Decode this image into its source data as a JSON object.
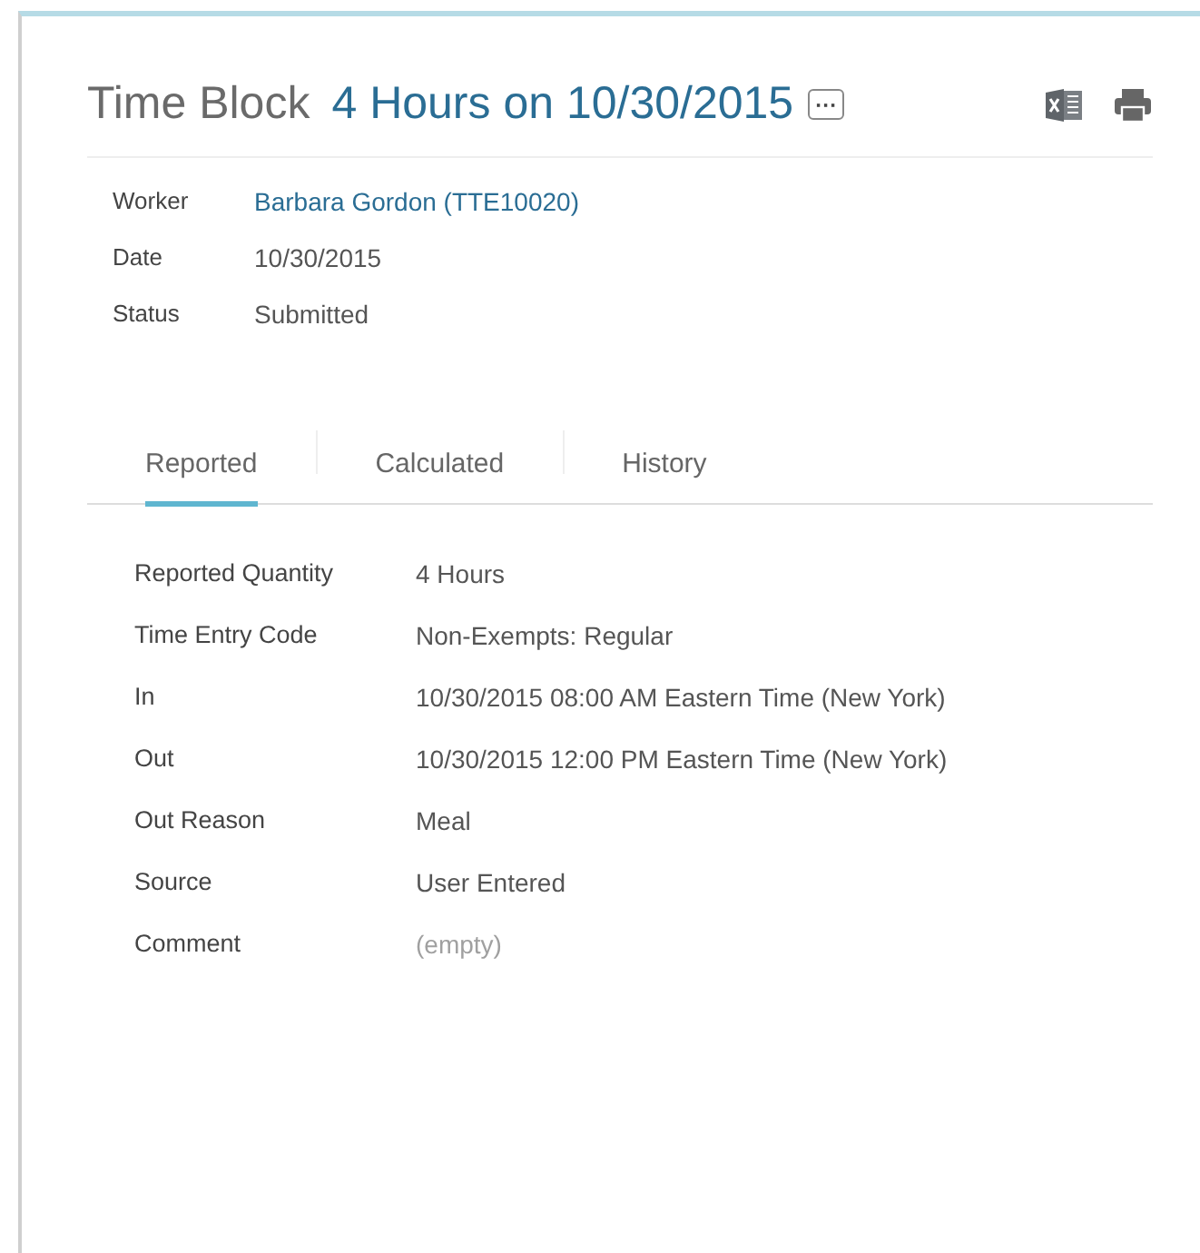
{
  "header": {
    "title": "Time Block",
    "subtitle": "4 Hours on 10/30/2015",
    "more_button": "···"
  },
  "summary": [
    {
      "label": "Worker",
      "value": "Barbara Gordon (TTE10020)",
      "kind": "link"
    },
    {
      "label": "Date",
      "value": "10/30/2015",
      "kind": "text"
    },
    {
      "label": "Status",
      "value": "Submitted",
      "kind": "text"
    }
  ],
  "tabs": [
    {
      "label": "Reported",
      "selected": true
    },
    {
      "label": "Calculated",
      "selected": false
    },
    {
      "label": "History",
      "selected": false
    }
  ],
  "details": [
    {
      "label": "Reported Quantity",
      "value": "4 Hours",
      "kind": "text"
    },
    {
      "label": "Time Entry Code",
      "value": "Non-Exempts: Regular",
      "kind": "text"
    },
    {
      "label": "In",
      "value": "10/30/2015 08:00 AM Eastern Time (New York)",
      "kind": "text"
    },
    {
      "label": "Out",
      "value": "10/30/2015 12:00 PM Eastern Time (New York)",
      "kind": "text"
    },
    {
      "label": "Out Reason",
      "value": "Meal",
      "kind": "text"
    },
    {
      "label": "Source",
      "value": "User Entered",
      "kind": "text"
    },
    {
      "label": "Comment",
      "value": "(empty)",
      "kind": "empty"
    }
  ]
}
